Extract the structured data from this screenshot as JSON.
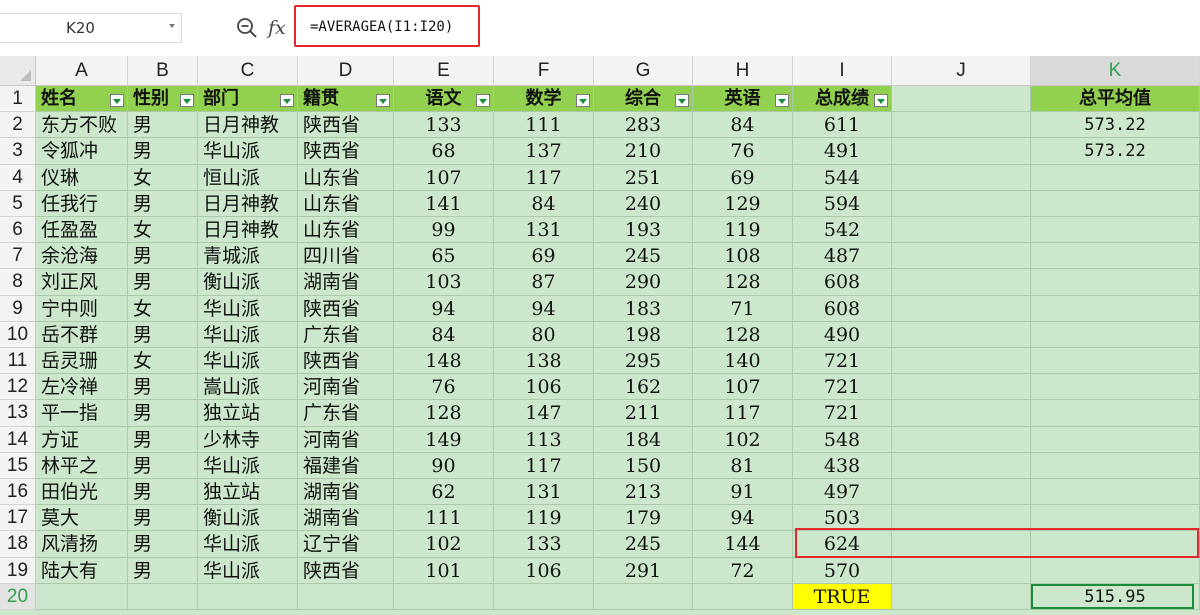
{
  "name_box": {
    "value": "K20",
    "dropdown_icon": "chevron-down-icon"
  },
  "formula_bar": {
    "zoom_icon": "zoom-icon",
    "fx_label": "fx",
    "formula": "=AVERAGEA(I1:I20)"
  },
  "columns": [
    "A",
    "B",
    "C",
    "D",
    "E",
    "F",
    "G",
    "H",
    "I",
    "J",
    "K"
  ],
  "selected_column": "K",
  "row_numbers": [
    "1",
    "2",
    "3",
    "4",
    "5",
    "6",
    "7",
    "8",
    "9",
    "10",
    "11",
    "12",
    "13",
    "14",
    "15",
    "16",
    "17",
    "18",
    "19",
    "20"
  ],
  "selected_row": "20",
  "headers": [
    "姓名",
    "性别",
    "部门",
    "籍贯",
    "语文",
    "数学",
    "综合",
    "英语",
    "总成绩"
  ],
  "rows": [
    [
      "东方不败",
      "男",
      "日月神教",
      "陕西省",
      "133",
      "111",
      "283",
      "84",
      "611"
    ],
    [
      "令狐冲",
      "男",
      "华山派",
      "陕西省",
      "68",
      "137",
      "210",
      "76",
      "491"
    ],
    [
      "仪琳",
      "女",
      "恒山派",
      "山东省",
      "107",
      "117",
      "251",
      "69",
      "544"
    ],
    [
      "任我行",
      "男",
      "日月神教",
      "山东省",
      "141",
      "84",
      "240",
      "129",
      "594"
    ],
    [
      "任盈盈",
      "女",
      "日月神教",
      "山东省",
      "99",
      "131",
      "193",
      "119",
      "542"
    ],
    [
      "余沧海",
      "男",
      "青城派",
      "四川省",
      "65",
      "69",
      "245",
      "108",
      "487"
    ],
    [
      "刘正风",
      "男",
      "衡山派",
      "湖南省",
      "103",
      "87",
      "290",
      "128",
      "608"
    ],
    [
      "宁中则",
      "女",
      "华山派",
      "陕西省",
      "94",
      "94",
      "183",
      "71",
      "608"
    ],
    [
      "岳不群",
      "男",
      "华山派",
      "广东省",
      "84",
      "80",
      "198",
      "128",
      "490"
    ],
    [
      "岳灵珊",
      "女",
      "华山派",
      "陕西省",
      "148",
      "138",
      "295",
      "140",
      "721"
    ],
    [
      "左冷禅",
      "男",
      "嵩山派",
      "河南省",
      "76",
      "106",
      "162",
      "107",
      "721"
    ],
    [
      "平一指",
      "男",
      "独立站",
      "广东省",
      "128",
      "147",
      "211",
      "117",
      "721"
    ],
    [
      "方证",
      "男",
      "少林寺",
      "河南省",
      "149",
      "113",
      "184",
      "102",
      "548"
    ],
    [
      "林平之",
      "男",
      "华山派",
      "福建省",
      "90",
      "117",
      "150",
      "81",
      "438"
    ],
    [
      "田伯光",
      "男",
      "独立站",
      "湖南省",
      "62",
      "131",
      "213",
      "91",
      "497"
    ],
    [
      "莫大",
      "男",
      "衡山派",
      "湖南省",
      "111",
      "119",
      "179",
      "94",
      "503"
    ],
    [
      "风清扬",
      "男",
      "华山派",
      "辽宁省",
      "102",
      "133",
      "245",
      "144",
      "624"
    ],
    [
      "陆大有",
      "男",
      "华山派",
      "陕西省",
      "101",
      "106",
      "291",
      "72",
      "570"
    ]
  ],
  "row20_total": "TRUE",
  "k_column": {
    "header": "总平均值",
    "k2": "573.22",
    "k3": "573.22",
    "k20": "515.95"
  },
  "colors": {
    "header_fill": "#92d050",
    "sheet_fill": "#cde7cd",
    "highlight": "#ffff00",
    "callout": "#e5262a",
    "select": "#1b8a3a"
  }
}
